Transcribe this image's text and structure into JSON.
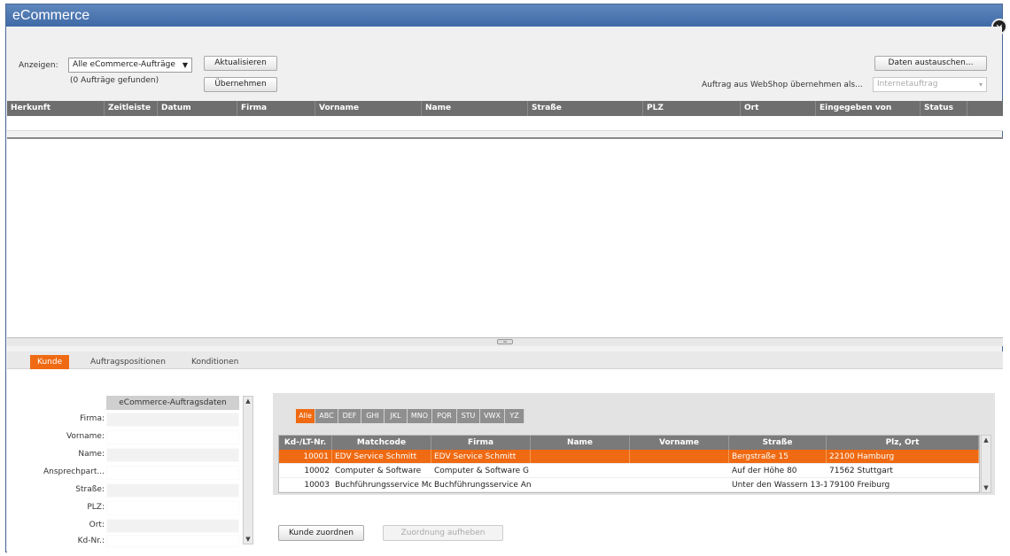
{
  "window": {
    "title": "eCommerce"
  },
  "toolbar": {
    "show_label": "Anzeigen:",
    "show_select_value": "Alle eCommerce-Aufträge",
    "orders_found": "(0 Aufträge gefunden)",
    "refresh_button": "Aktualisieren",
    "accept_button": "Übernehmen",
    "exchange_button": "Daten austauschen...",
    "import_label": "Auftrag aus WebShop übernehmen als...",
    "import_select_value": "Internetauftrag"
  },
  "orders_grid": {
    "columns": [
      "Herkunft",
      "Zeitleiste",
      "Datum",
      "Firma",
      "Vorname",
      "Name",
      "Straße",
      "PLZ",
      "Ort",
      "Eingegeben von",
      "Status"
    ]
  },
  "tabs": [
    "Kunde",
    "Auftragspositionen",
    "Konditionen"
  ],
  "customer_form": {
    "header": "eCommerce-Auftragsdaten",
    "fields": [
      "Firma:",
      "Vorname:",
      "Name:",
      "Ansprechpart...",
      "Straße:",
      "PLZ:",
      "Ort:",
      "Kd-Nr.:"
    ]
  },
  "alpha_filter": [
    "Alle",
    "ABC",
    "DEF",
    "GHI",
    "JKL",
    "MNO",
    "PQR",
    "STU",
    "VWX",
    "YZ"
  ],
  "customer_table": {
    "columns": [
      "Kd-/LT-Nr.",
      "Matchcode",
      "Firma",
      "Name",
      "Vorname",
      "Straße",
      "Plz, Ort"
    ],
    "rows": [
      [
        "10001",
        "EDV Service Schmitt",
        "EDV Service Schmitt",
        "",
        "",
        "Bergstraße 15",
        "22100 Hamburg"
      ],
      [
        "10002",
        "Computer & Software",
        "Computer & Software G",
        "",
        "",
        "Auf der Höhe 80",
        "71562 Stuttgart"
      ],
      [
        "10003",
        "Buchführungsservice Mc",
        "Buchführungsservice An",
        "",
        "",
        "Unter den Wassern 13-1",
        "79100 Freiburg"
      ]
    ],
    "selected_row": 0
  },
  "actions": {
    "assign_customer": "Kunde zuordnen",
    "cancel_assignment": "Zuordnung aufheben"
  }
}
